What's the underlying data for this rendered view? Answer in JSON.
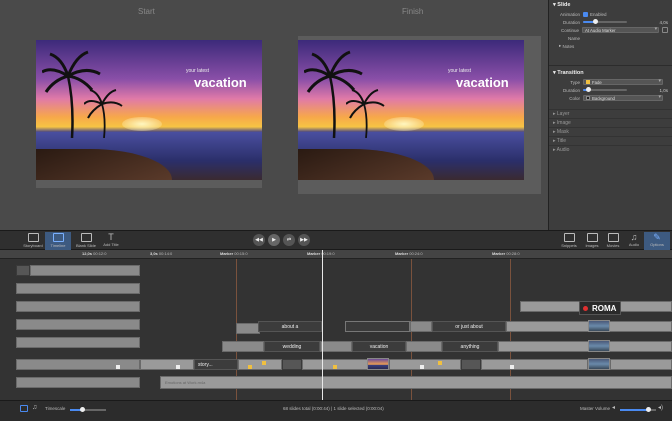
{
  "preview": {
    "start_label": "Start",
    "finish_label": "Finish",
    "slide_small_text": "your latest",
    "slide_big_text": "vacation"
  },
  "inspector": {
    "slide_header": "Slide",
    "animation_label": "Animation",
    "animation_value": "Enabled",
    "duration_label": "Duration",
    "duration_value": "4,0s",
    "duration_fraction": 0.28,
    "continue_label": "Continue",
    "continue_value": "At Audio Marker",
    "name_label": "Name",
    "notes_label": "Notes",
    "transition_header": "Transition",
    "type_label": "Type",
    "type_value": "Fade",
    "t_duration_label": "Duration",
    "t_duration_value": "1,0s",
    "t_duration_fraction": 0.12,
    "color_label": "Color",
    "color_value": "Background",
    "collapsed_sections": [
      "Layer",
      "Image",
      "Mask",
      "Title",
      "Audio"
    ]
  },
  "toolbar": {
    "storyboard": "Storyboard",
    "timeline": "Timeline",
    "blank_slide": "Blank Slide",
    "add_title": "Add Title",
    "snippets": "Snippets",
    "images": "Images",
    "movies": "Movies",
    "audio": "Audio",
    "options": "Options"
  },
  "ruler": {
    "t1": "12,0s",
    "t1b": "00:12:0",
    "t2": "3,0s",
    "t2b": "00:14:0",
    "m1": "Marker",
    "m1b": "00:15:0",
    "m2": "Marker",
    "m2b": "00:19:0",
    "m3": "Marker",
    "m3b": "00:24:0",
    "m4": "Marker",
    "m4b": "00:28:0"
  },
  "timeline": {
    "roma": "ROMA",
    "about": "about a",
    "or_just_about": "or just about",
    "wedding": "wedding",
    "vacation": "vacation",
    "anything": "anything",
    "story": "story...",
    "audio_track": "Emotions at Work.m4a"
  },
  "status": {
    "timescale": "Timescale",
    "summary": "68 slides total (0:00:44) | 1 slide selected (0:00:04)",
    "master_volume": "Master Volume",
    "timescale_fraction": 0.35,
    "volume_fraction": 0.8
  }
}
